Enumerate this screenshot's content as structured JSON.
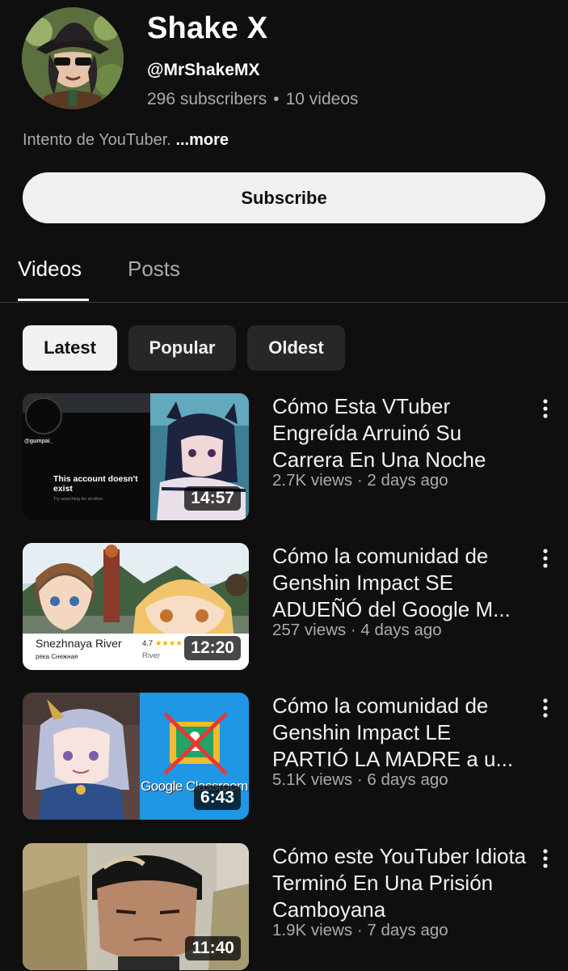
{
  "channel": {
    "name": "Shake X",
    "handle": "@MrShakeMX",
    "subscribers": "296 subscribers",
    "separator": "•",
    "videos_count": "10 videos",
    "description": "Intento de YouTuber.",
    "more_label": "...more"
  },
  "subscribe_label": "Subscribe",
  "tabs": [
    {
      "label": "Videos",
      "active": true
    },
    {
      "label": "Posts",
      "active": false
    }
  ],
  "chips": [
    {
      "label": "Latest",
      "active": true
    },
    {
      "label": "Popular",
      "active": false
    },
    {
      "label": "Oldest",
      "active": false
    }
  ],
  "videos": [
    {
      "title": "Cómo Esta VTuber Engreída Arruinó Su Carrera En Una Noche",
      "meta": "2.7K views · 2 days ago",
      "duration": "14:57",
      "thumb_text": {
        "handle": "@gumpai_",
        "headline": "This account doesn't exist",
        "sub": "Try searching for another."
      }
    },
    {
      "title": "Cómo la comunidad de Genshin Impact SE ADUEÑÓ del Google M...",
      "meta": "257 views · 4 days ago",
      "duration": "12:20",
      "thumb_text": {
        "place": "Snezhnaya River",
        "place_ru": "река Снежная",
        "rating": "4.7",
        "stars": "★★★★",
        "type": "River"
      }
    },
    {
      "title": "Cómo la comunidad de Genshin Impact LE PARTIÓ LA MADRE a u...",
      "meta": "5.1K views · 6 days ago",
      "duration": "6:43",
      "thumb_text": {
        "brand": "Google Classroom"
      }
    },
    {
      "title": "Cómo este YouTuber Idiota Terminó En Una Prisión Camboyana",
      "meta": "1.9K views · 7 days ago",
      "duration": "11:40",
      "thumb_text": {}
    }
  ]
}
